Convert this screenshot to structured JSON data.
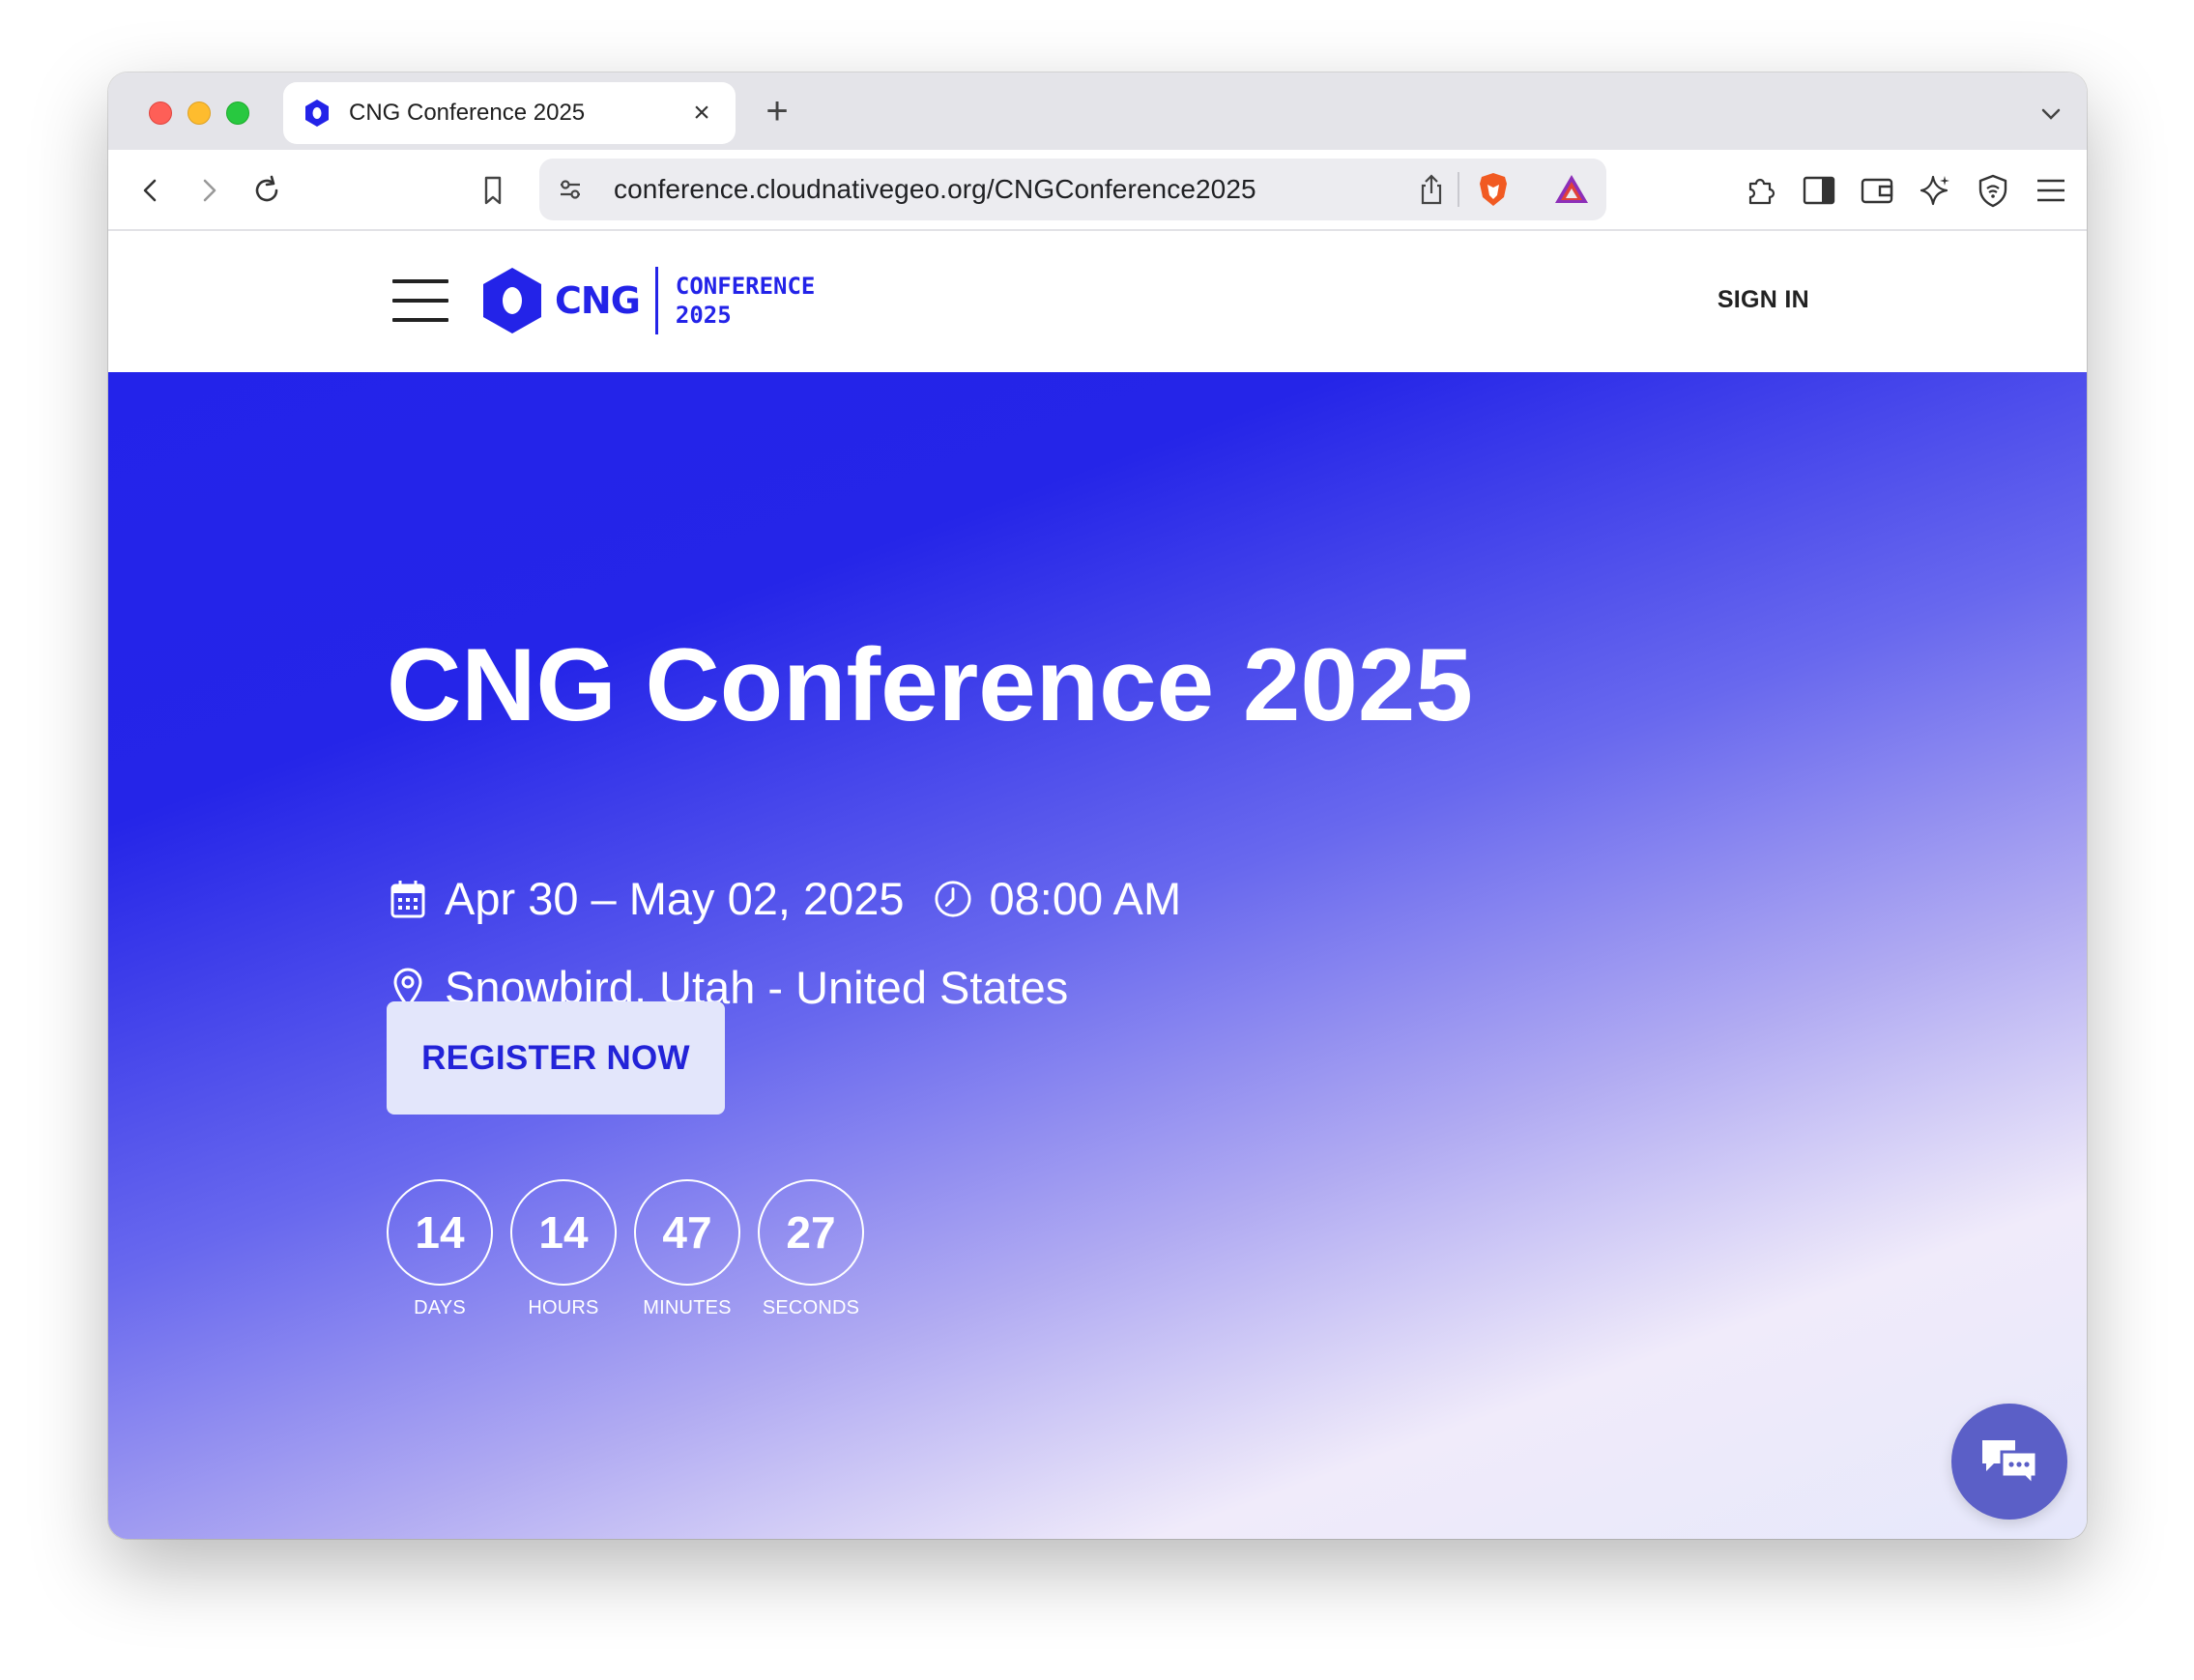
{
  "browser": {
    "tab_title": "CNG Conference 2025",
    "url": "conference.cloudnativegeo.org/CNGConference2025"
  },
  "header": {
    "logo_text": "CNG",
    "logo_sub_line1": "CONFERENCE",
    "logo_sub_line2": "2025",
    "sign_in": "SIGN IN"
  },
  "hero": {
    "title": "CNG Conference 2025",
    "dates": "Apr 30 – May 02, 2025",
    "time": "08:00 AM",
    "location": "Snowbird, Utah - United States",
    "register_label": "REGISTER NOW"
  },
  "countdown": [
    {
      "value": "14",
      "label": "DAYS"
    },
    {
      "value": "14",
      "label": "HOURS"
    },
    {
      "value": "47",
      "label": "MINUTES"
    },
    {
      "value": "27",
      "label": "SECONDS"
    }
  ],
  "colors": {
    "brand": "#2323e8",
    "chat_button": "#5b5fc7"
  }
}
